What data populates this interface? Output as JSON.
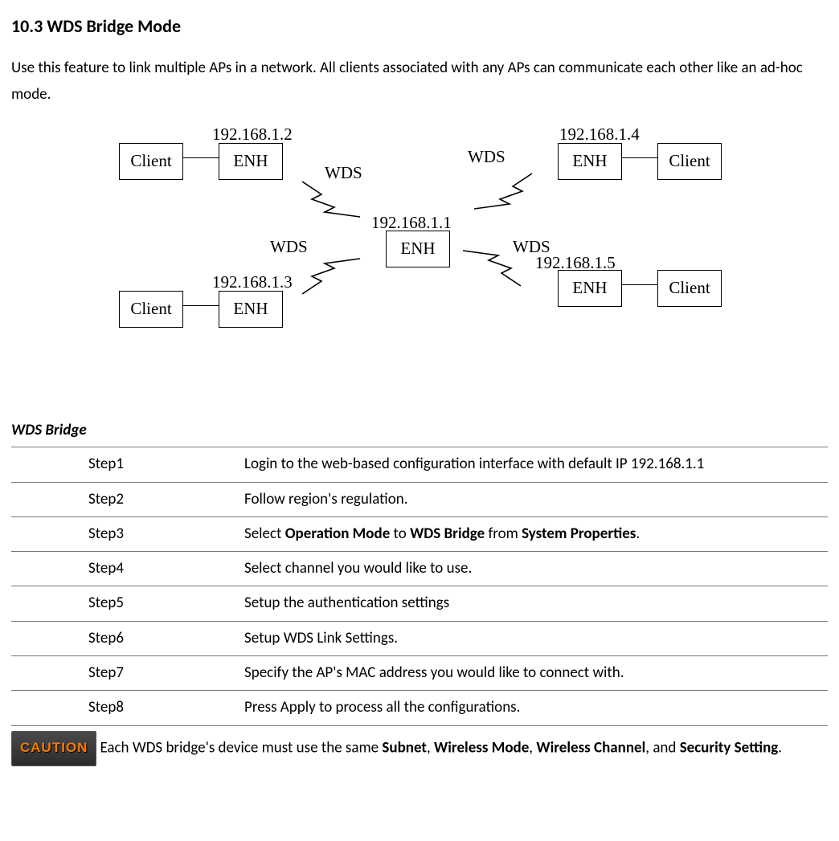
{
  "section": {
    "heading": "10.3 WDS Bridge Mode",
    "intro": "Use this feature to link multiple APs in a network. All clients associated with any APs can communicate each other like an ad-hoc mode."
  },
  "diagram": {
    "center": {
      "label": "ENH",
      "ip": "192.168.1.1"
    },
    "tl": {
      "enh": "ENH",
      "ip": "192.168.1.2",
      "client": "Client",
      "wds": "WDS"
    },
    "bl": {
      "enh": "ENH",
      "ip": "192.168.1.3",
      "client": "Client",
      "wds": "WDS"
    },
    "tr": {
      "enh": "ENH",
      "ip": "192.168.1.4",
      "client": "Client",
      "wds": "WDS"
    },
    "br": {
      "enh": "ENH",
      "ip": "192.168.1.5",
      "client": "Client",
      "wds": "WDS"
    }
  },
  "table": {
    "title": "WDS Bridge",
    "steps": [
      {
        "name": "Step1",
        "desc_pre": "Login to the web-based configuration interface with default IP 192.168.1.1"
      },
      {
        "name": "Step2",
        "desc_pre": "Follow region's regulation."
      },
      {
        "name": "Step3",
        "desc_pre": "Select ",
        "b1": "Operation Mode",
        "mid1": " to ",
        "b2": "WDS Bridge",
        "mid2": " from ",
        "b3": "System Properties",
        "post": "."
      },
      {
        "name": "Step4",
        "desc_pre": "Select channel you would like to use."
      },
      {
        "name": "Step5",
        "desc_pre": "Setup the authentication settings"
      },
      {
        "name": "Step6",
        "desc_pre": "Setup WDS Link Settings."
      },
      {
        "name": "Step7",
        "desc_pre": "Specify the AP's MAC address you would like to connect with."
      },
      {
        "name": "Step8",
        "desc_pre": "Press Apply to process all the configurations."
      }
    ]
  },
  "caution": {
    "badge": "CAUTION",
    "pre": "Each WDS bridge's device must use the same ",
    "b1": "Subnet",
    "c1": ", ",
    "b2": "Wireless Mode",
    "c2": ", ",
    "b3": "Wireless Channel",
    "c3": ", and ",
    "b4": "Security Setting",
    "post": "."
  }
}
